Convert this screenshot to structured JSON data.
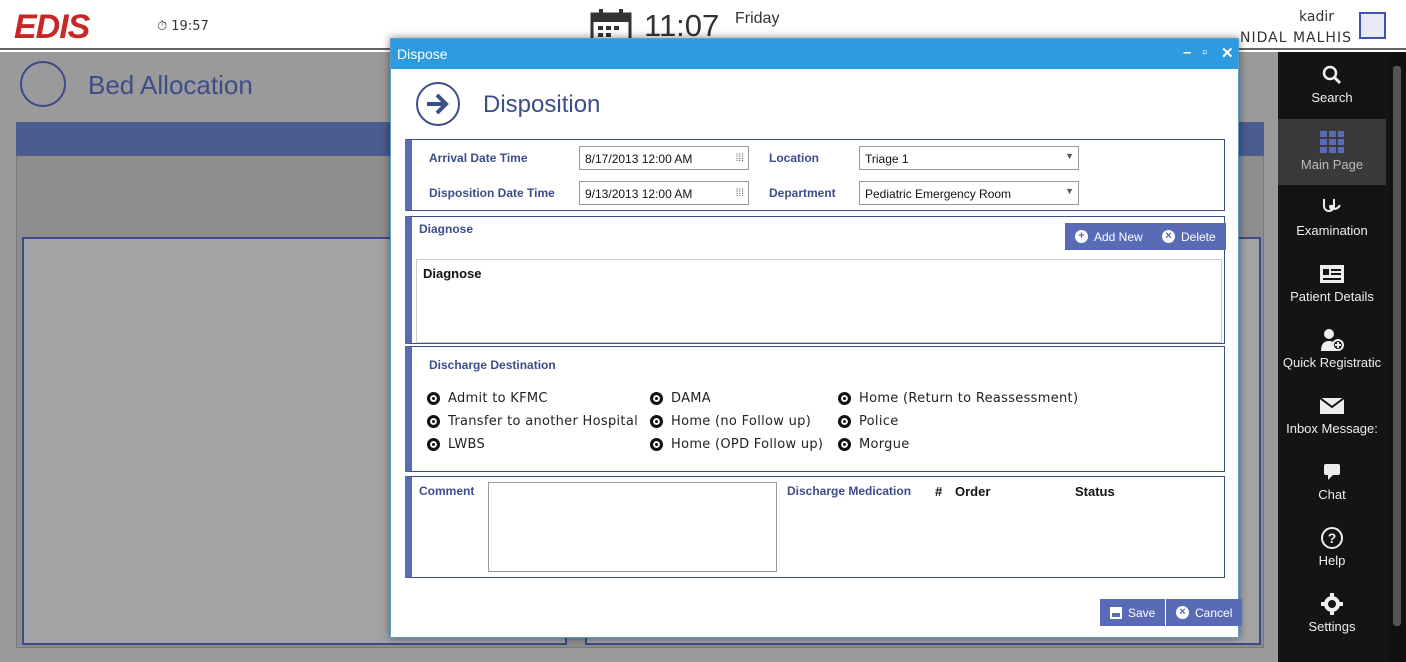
{
  "app": {
    "logo": "EDIS",
    "timer": "19:57",
    "clock": "11:07",
    "day": "Friday",
    "user_login": "kadir",
    "user_name": "NIDAL  MALHIS"
  },
  "background": {
    "page_title": "Bed Allocation"
  },
  "sidebar": {
    "items": [
      {
        "label": "Search",
        "icon": "search-icon"
      },
      {
        "label": "Main Page",
        "icon": "grid-icon"
      },
      {
        "label": "Examination",
        "icon": "stethoscope-icon"
      },
      {
        "label": "Patient Details",
        "icon": "id-card-icon"
      },
      {
        "label": "Quick Registratic",
        "icon": "add-user-icon"
      },
      {
        "label": "Inbox Message:",
        "icon": "envelope-icon"
      },
      {
        "label": "Chat",
        "icon": "chat-icon"
      },
      {
        "label": "Help",
        "icon": "help-icon"
      },
      {
        "label": "Settings",
        "icon": "gear-icon"
      }
    ]
  },
  "modal": {
    "window_title": "Dispose",
    "heading": "Disposition",
    "arrival_label": "Arrival Date Time",
    "arrival_value": "8/17/2013 12:00 AM",
    "disposition_label": "Disposition Date Time",
    "disposition_value": "9/13/2013 12:00 AM",
    "location_label": "Location",
    "location_value": "Triage 1",
    "department_label": "Department",
    "department_value": "Pediatric Emergency Room",
    "diagnose_label": "Diagnose",
    "add_new": "Add New",
    "delete": "Delete",
    "diagnose_column": "Diagnose",
    "discharge_destination_label": "Discharge Destination",
    "destinations": [
      "Admit to KFMC",
      "Transfer to another Hospital",
      "LWBS",
      "DAMA",
      "Home (no Follow up)",
      "Home (OPD Follow up)",
      "Home (Return to Reassessment)",
      "Police",
      "Morgue"
    ],
    "comment_label": "Comment",
    "discharge_medication_label": "Discharge Medication",
    "med_cols": [
      "#",
      "Order",
      "Status"
    ],
    "save": "Save",
    "cancel": "Cancel"
  }
}
